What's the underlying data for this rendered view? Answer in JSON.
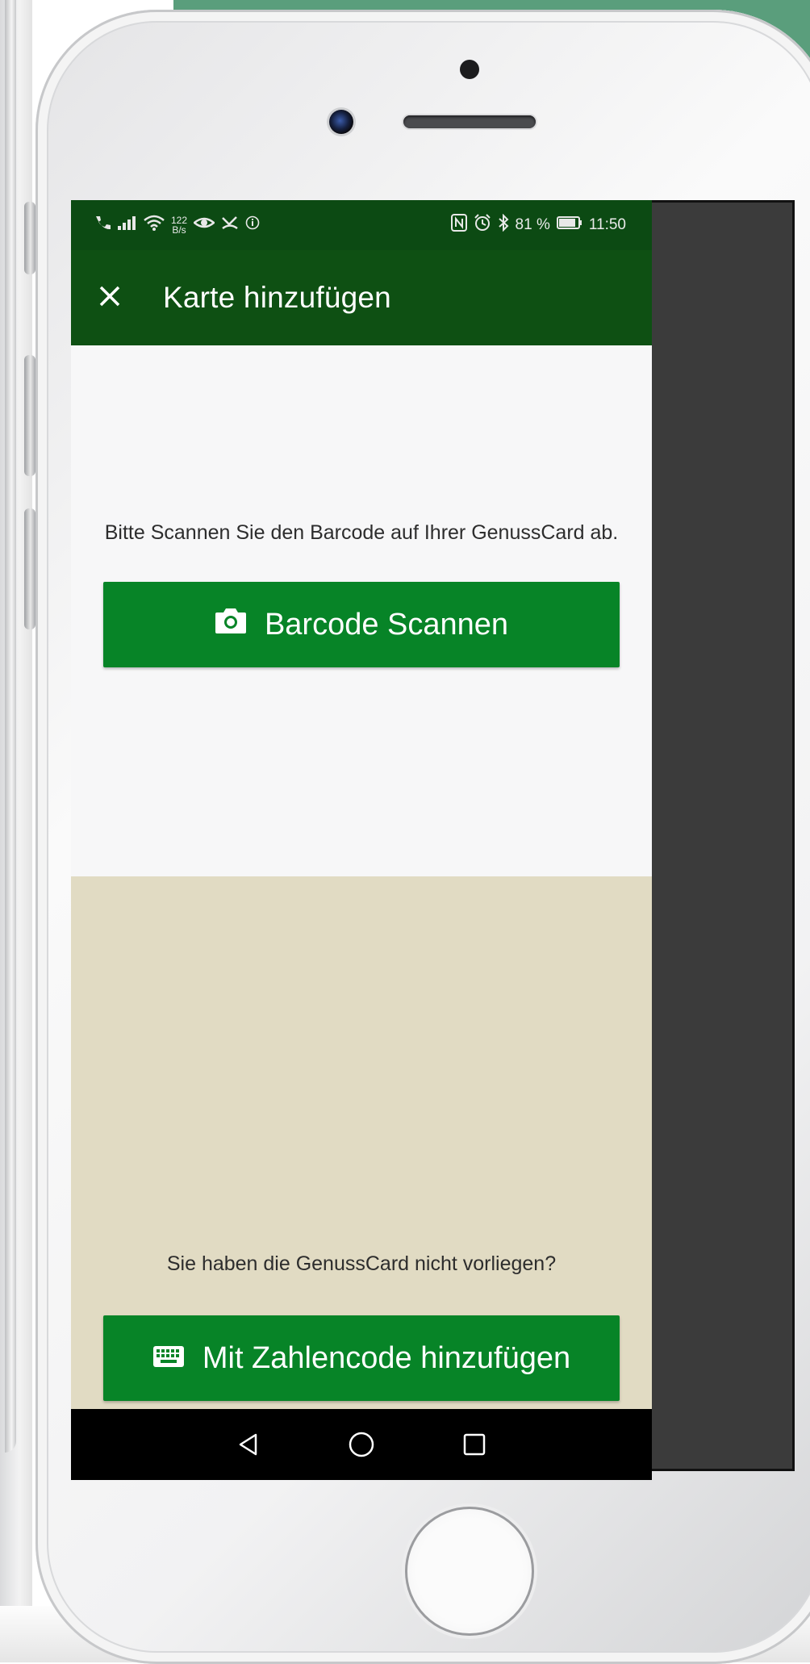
{
  "status_bar": {
    "left_icons": [
      "call-icon",
      "signal-icon",
      "wifi-icon",
      "eye-icon",
      "missed-call-icon",
      "info-icon"
    ],
    "net_speed_value": "122",
    "net_speed_unit": "B/s",
    "battery_percent": "81 %",
    "time": "11:50"
  },
  "app_bar": {
    "close_icon": "close-icon",
    "title": "Karte hinzufügen"
  },
  "scan_section": {
    "instruction": "Bitte Scannen Sie den Barcode auf Ihrer GenussCard ab.",
    "button_label": "Barcode Scannen",
    "button_icon": "camera-icon"
  },
  "manual_section": {
    "question": "Sie haben die GenussCard nicht vorliegen?",
    "button_label": "Mit Zahlencode hinzufügen",
    "button_icon": "keyboard-icon"
  },
  "nav_bar": {
    "icons": [
      "back-icon",
      "home-icon",
      "recent-apps-icon"
    ]
  },
  "colors": {
    "status_bar": "#0c4a13",
    "app_bar": "#0e5013",
    "button": "#078427",
    "manual_bg": "#e1dbc3",
    "scan_bg": "#f7f7f8"
  }
}
